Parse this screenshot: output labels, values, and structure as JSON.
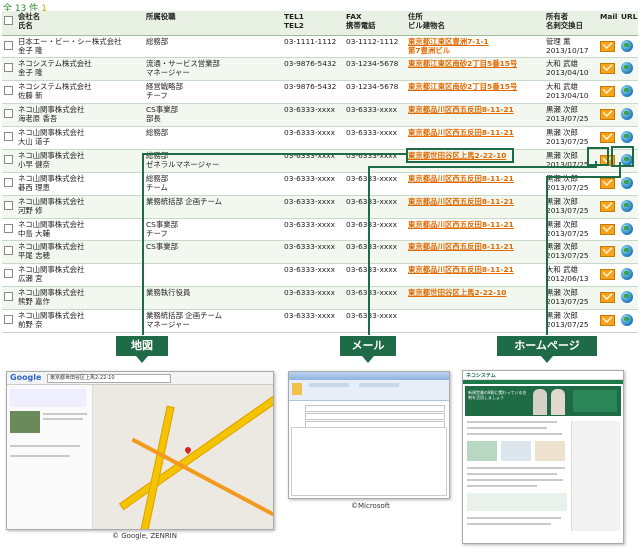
{
  "summary": {
    "total": "全 13 件",
    "page": "1"
  },
  "columns": [
    {
      "l1": "会社名",
      "l2": "氏名"
    },
    {
      "l1": "所属役職",
      "l2": ""
    },
    {
      "l1": "TEL1",
      "l2": "TEL2"
    },
    {
      "l1": "FAX",
      "l2": "携帯電話"
    },
    {
      "l1": "住所",
      "l2": "ビル建物名"
    },
    {
      "l1": "所有者",
      "l2": "名刺交換日"
    },
    {
      "l1": "Mail",
      "l2": ""
    },
    {
      "l1": "URL",
      "l2": ""
    }
  ],
  "rows": [
    {
      "company": "日本エー・ビー・シー株式会社",
      "name": "金子 隆",
      "dept": "総務部",
      "dept2": "",
      "tel1": "03-1111-1112",
      "tel2": "",
      "fax": "03-1112-1112",
      "mobile": "",
      "addr": "東京都江東区豊洲7-1-1",
      "bldg": "第7豊洲ビル",
      "owner": "管理 薫",
      "date": "2013/10/17"
    },
    {
      "company": "ネコシステム株式会社",
      "name": "金子 隆",
      "dept": "流通・サービス営業部",
      "dept2": "マネージャー",
      "tel1": "03-9876-5432",
      "tel2": "",
      "fax": "03-1234-5678",
      "mobile": "",
      "addr": "東京都江東区南砂2丁目5番15号",
      "bldg": "",
      "owner": "大和 武雄",
      "date": "2013/04/10"
    },
    {
      "company": "ネコシステム株式会社",
      "name": "佐藤 新",
      "dept": "経営戦略部",
      "dept2": "チーフ",
      "tel1": "03-9876-5432",
      "tel2": "",
      "fax": "03-1234-5678",
      "mobile": "",
      "addr": "東京都江東区南砂2丁目5番15号",
      "bldg": "",
      "owner": "大和 武雄",
      "date": "2013/04/10"
    },
    {
      "company": "ネコ山関事株式会社",
      "name": "海老原 香吾",
      "dept": "CS事業部",
      "dept2": "部長",
      "tel1": "03-6333-xxxx",
      "tel2": "",
      "fax": "03-6333-xxxx",
      "mobile": "",
      "addr": "東京都品川区西五反田8-11-21",
      "bldg": "",
      "owner": "黒瀬 次郎",
      "date": "2013/07/25"
    },
    {
      "company": "ネコ山関事株式会社",
      "name": "大山 道子",
      "dept": "総務部",
      "dept2": "",
      "tel1": "03-6333-xxxx",
      "tel2": "",
      "fax": "03-6333-xxxx",
      "mobile": "",
      "addr": "東京都品川区西五反田8-11-21",
      "bldg": "",
      "owner": "黒瀬 次郎",
      "date": "2013/07/25"
    },
    {
      "company": "ネコ山関事株式会社",
      "name": "小早 健奈",
      "dept": "総務部",
      "dept2": "ゼネラルマネージャー",
      "tel1": "03-6333-xxxx",
      "tel2": "",
      "fax": "03-6333-xxxx",
      "mobile": "",
      "addr": "東京都世田谷区上馬2-22-10",
      "bldg": "",
      "owner": "黒瀬 次郎",
      "date": "2013/07/25"
    },
    {
      "company": "ネコ山関事株式会社",
      "name": "碁西 理恵",
      "dept": "総務部",
      "dept2": "チーム",
      "tel1": "03-6333-xxxx",
      "tel2": "",
      "fax": "03-6333-xxxx",
      "mobile": "",
      "addr": "東京都品川区西五反田8-11-21",
      "bldg": "",
      "owner": "黒瀬 次郎",
      "date": "2013/07/25"
    },
    {
      "company": "ネコ山関事株式会社",
      "name": "河野 修",
      "dept": "業務統括部 企画チーム",
      "dept2": "",
      "tel1": "03-6333-xxxx",
      "tel2": "",
      "fax": "03-6333-xxxx",
      "mobile": "",
      "addr": "東京都品川区西五反田8-11-21",
      "bldg": "",
      "owner": "黒瀬 次郎",
      "date": "2013/07/25"
    },
    {
      "company": "ネコ山関事株式会社",
      "name": "中島 大輔",
      "dept": "CS事業部",
      "dept2": "チーフ",
      "tel1": "03-6333-xxxx",
      "tel2": "",
      "fax": "03-6333-xxxx",
      "mobile": "",
      "addr": "東京都品川区西五反田8-11-21",
      "bldg": "",
      "owner": "黒瀬 次郎",
      "date": "2013/07/25"
    },
    {
      "company": "ネコ山関事株式会社",
      "name": "平尾 志穂",
      "dept": "CS事業部",
      "dept2": "",
      "tel1": "03-6333-xxxx",
      "tel2": "",
      "fax": "03-6333-xxxx",
      "mobile": "",
      "addr": "東京都品川区西五反田8-11-21",
      "bldg": "",
      "owner": "黒瀬 次郎",
      "date": "2013/07/25"
    },
    {
      "company": "ネコ山関事株式会社",
      "name": "広瀬 宮",
      "dept": "",
      "dept2": "",
      "tel1": "03-6333-xxxx",
      "tel2": "",
      "fax": "03-6333-xxxx",
      "mobile": "",
      "addr": "東京都品川区西五反田8-11-21",
      "bldg": "",
      "owner": "大和 武雄",
      "date": "2012/06/13"
    },
    {
      "company": "ネコ山関事株式会社",
      "name": "熊野 嘉作",
      "dept": "業務執行役員",
      "dept2": "",
      "tel1": "03-6333-xxxx",
      "tel2": "",
      "fax": "03-6333-xxxx",
      "mobile": "",
      "addr": "東京都世田谷区上馬2-22-10",
      "bldg": "",
      "owner": "黒瀬 次郎",
      "date": "2013/07/25"
    },
    {
      "company": "ネコ山関事株式会社",
      "name": "前野 奈",
      "dept": "業務統括部 企画チーム",
      "dept2": "マネージャー",
      "tel1": "03-6333-xxxx",
      "tel2": "",
      "fax": "03-6333-xxxx",
      "mobile": "",
      "addr": "",
      "bldg": "",
      "owner": "黒瀬 次郎",
      "date": "2013/07/25"
    }
  ],
  "callouts": {
    "map": "地図",
    "mail": "メール",
    "homepage": "ホームページ"
  },
  "map_shot": {
    "logo": "Google",
    "search": "東京都世田谷区上馬2-22-10",
    "credit": "© Google, ZENRIN"
  },
  "mail_shot": {
    "credit": "©Microsoft"
  },
  "homepage_shot": {
    "logo": "ネコシステム",
    "hero": "新規営業の8割に関わっている名刺を活用しましょう"
  },
  "colors": {
    "accent": "#1e6b45",
    "address_link": "#e06a00",
    "mail_icon": "#f7a21a"
  }
}
